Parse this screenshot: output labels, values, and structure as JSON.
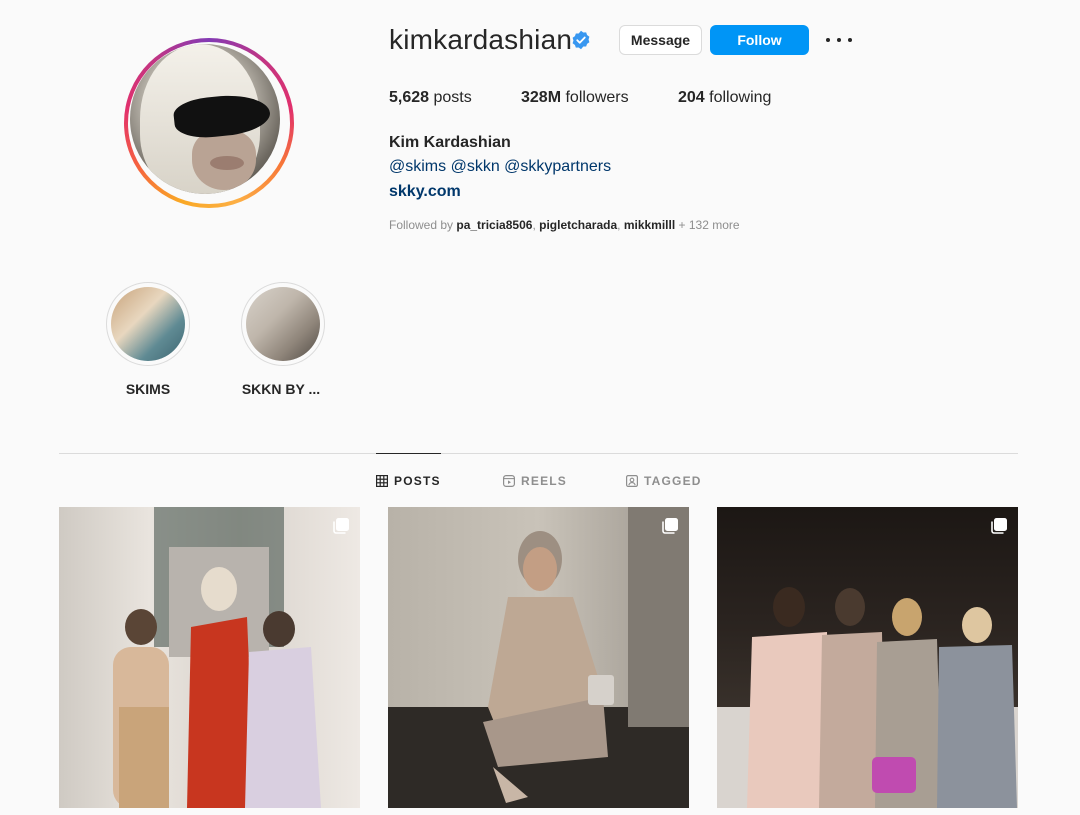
{
  "profile": {
    "username": "kimkardashian",
    "verified": true,
    "message_label": "Message",
    "follow_label": "Follow",
    "stats": {
      "posts_count": "5,628",
      "posts_label": "posts",
      "followers_count": "328M",
      "followers_label": "followers",
      "following_count": "204",
      "following_label": "following"
    },
    "full_name": "Kim Kardashian",
    "bio_mentions": "@skims @skkn @skkypartners",
    "website": "skky.com",
    "followed_by": {
      "prefix": "Followed by ",
      "users": [
        "pa_tricia8506",
        "pigletcharada",
        "mikkmilll"
      ],
      "more": " + 132 more"
    }
  },
  "highlights": [
    {
      "label": "SKIMS"
    },
    {
      "label": "SKKN BY ..."
    }
  ],
  "tabs": [
    {
      "label": "POSTS",
      "icon": "grid-icon",
      "active": true
    },
    {
      "label": "REELS",
      "icon": "reels-icon",
      "active": false
    },
    {
      "label": "TAGGED",
      "icon": "tagged-icon",
      "active": false
    }
  ],
  "posts": [
    {
      "type": "carousel"
    },
    {
      "type": "carousel"
    },
    {
      "type": "carousel"
    }
  ],
  "colors": {
    "accent": "#0095f6",
    "link": "#00376b",
    "text": "#262626",
    "muted": "#8e8e8e",
    "background": "#fafafa"
  }
}
